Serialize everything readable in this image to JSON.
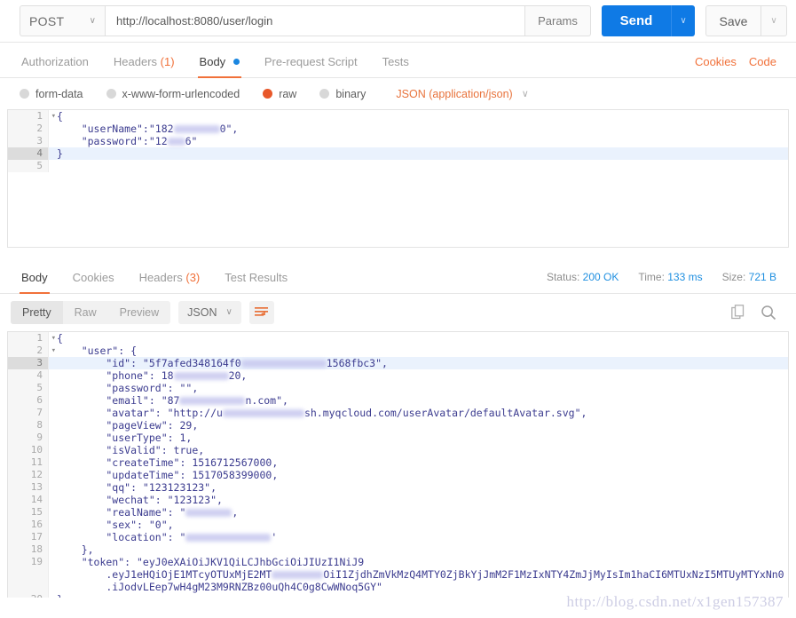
{
  "request_bar": {
    "method": "POST",
    "method_caret": "∨",
    "url": "http://localhost:8080/user/login",
    "params_label": "Params",
    "send_label": "Send",
    "send_caret": "∨",
    "save_label": "Save",
    "save_caret": "∨",
    "accent_blue": "#0f7ae5"
  },
  "request_tabs": {
    "items": [
      {
        "label": "Authorization",
        "active": false
      },
      {
        "label": "Headers",
        "count": "(1)",
        "active": false
      },
      {
        "label": "Body",
        "active": true,
        "dot": true
      },
      {
        "label": "Pre-request Script",
        "active": false
      },
      {
        "label": "Tests",
        "active": false
      }
    ],
    "cookies_label": "Cookies",
    "code_label": "Code",
    "accent_orange": "#f1713a"
  },
  "body_type": {
    "options": [
      {
        "label": "form-data",
        "checked": false
      },
      {
        "label": "x-www-form-urlencoded",
        "checked": false
      },
      {
        "label": "raw",
        "checked": true
      },
      {
        "label": "binary",
        "checked": false
      }
    ],
    "content_type": "JSON (application/json)",
    "content_type_caret": "∨",
    "checked_color": "#e8582a"
  },
  "request_body": {
    "lines": [
      {
        "n": "1",
        "fold": "▾",
        "text": "{",
        "highlight": false
      },
      {
        "n": "2",
        "text": "    \"userName\":\"182",
        "blur_w": 52,
        "text2": "0\",",
        "highlight": false
      },
      {
        "n": "3",
        "text": "    \"password\":\"12",
        "blur_w": 20,
        "text2": "6\"",
        "highlight": false
      },
      {
        "n": "4",
        "text": "}",
        "highlight": true
      },
      {
        "n": "5",
        "text": "",
        "highlight": false
      }
    ]
  },
  "response_tabs": {
    "items": [
      {
        "label": "Body",
        "active": true
      },
      {
        "label": "Cookies",
        "active": false
      },
      {
        "label": "Headers",
        "count": "(3)",
        "active": false
      },
      {
        "label": "Test Results",
        "active": false
      }
    ],
    "status_label": "Status:",
    "status_value": "200 OK",
    "time_label": "Time:",
    "time_value": "133 ms",
    "size_label": "Size:",
    "size_value": "721 B",
    "value_color": "#1f8fe0"
  },
  "response_toolbar": {
    "view_modes": [
      {
        "label": "Pretty",
        "active": true
      },
      {
        "label": "Raw",
        "active": false
      },
      {
        "label": "Preview",
        "active": false
      }
    ],
    "format": "JSON",
    "format_caret": "∨",
    "wrap_icon": "word-wrap-icon",
    "copy_icon": "copy-icon",
    "search_icon": "search-icon",
    "wrap_color": "#e8733c"
  },
  "response_body": {
    "lines": [
      {
        "n": "1",
        "fold": "▾",
        "text": "{",
        "highlight": false
      },
      {
        "n": "2",
        "fold": "▾",
        "text": "    \"user\": {",
        "highlight": false
      },
      {
        "n": "3",
        "text": "        \"id\": \"5f7afed348164f0",
        "blur_w": 96,
        "text2": "1568fbc3\",",
        "highlight": true
      },
      {
        "n": "4",
        "text": "        \"phone\": 18",
        "blur_w": 62,
        "text2": "20,",
        "highlight": false
      },
      {
        "n": "5",
        "text": "        \"password\": \"\",",
        "highlight": false
      },
      {
        "n": "6",
        "text": "        \"email\": \"87",
        "blur_w": 74,
        "text2": "n.com\",",
        "highlight": false
      },
      {
        "n": "7",
        "text": "        \"avatar\": \"http://u",
        "blur_w": 92,
        "text2": "sh.myqcloud.com/userAvatar/defaultAvatar.svg\",",
        "highlight": false
      },
      {
        "n": "8",
        "text": "        \"pageView\": 29,",
        "highlight": false
      },
      {
        "n": "9",
        "text": "        \"userType\": 1,",
        "highlight": false
      },
      {
        "n": "10",
        "text": "        \"isValid\": true,",
        "highlight": false
      },
      {
        "n": "11",
        "text": "        \"createTime\": 1516712567000,",
        "highlight": false
      },
      {
        "n": "12",
        "text": "        \"updateTime\": 1517058399000,",
        "highlight": false
      },
      {
        "n": "13",
        "text": "        \"qq\": \"123123123\",",
        "highlight": false
      },
      {
        "n": "14",
        "text": "        \"wechat\": \"123123\",",
        "highlight": false
      },
      {
        "n": "15",
        "text": "        \"realName\": \"",
        "blur_w": 52,
        "text2": ",",
        "highlight": false
      },
      {
        "n": "16",
        "text": "        \"sex\": \"0\",",
        "highlight": false
      },
      {
        "n": "17",
        "text": "        \"location\": \"",
        "blur_w": 96,
        "text2": "'",
        "highlight": false
      },
      {
        "n": "18",
        "text": "    },",
        "highlight": false
      },
      {
        "n": "19",
        "text": "    \"token\": \"eyJ0eXAiOiJKV1QiLCJhbGciOiJIUzI1NiJ9",
        "highlight": false
      },
      {
        "n": "",
        "text": "        .eyJ1eHQiOjE1MTcyOTUxMjE2MT",
        "blur_w": 58,
        "text2": "OiI1ZjdhZmVkMzQ4MTY0ZjBkYjJmM2F1MzIxNTY4ZmJjMyIsIm1haCI6MTUxNzI5MTUyMTYxNn0",
        "highlight": false
      },
      {
        "n": "",
        "text": "        .iJodvLEep7wH4gM23M9RNZBz00uQh4C0g8CwWNoq5GY\"",
        "highlight": false
      },
      {
        "n": "20",
        "text": "}",
        "highlight": false
      }
    ]
  },
  "watermark": "http://blog.csdn.net/x1gen157387"
}
